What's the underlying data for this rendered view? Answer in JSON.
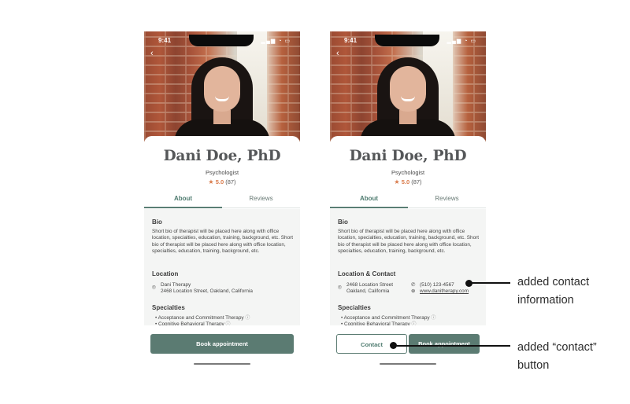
{
  "status": {
    "time": "9:41",
    "system_icons": "signal-wifi-battery"
  },
  "profile": {
    "name": "Dani Doe, PhD",
    "role": "Psychologist",
    "rating": "5.0",
    "review_count": "(87)"
  },
  "tabs": {
    "about": "About",
    "reviews": "Reviews"
  },
  "bio": {
    "heading": "Bio",
    "text": "Short bio of therapist will be placed here along with office location, specialties, education, training, background, etc. Short bio of therapist will be placed here along with office location, specialties, education, training, background, etc."
  },
  "location": {
    "heading": "Location",
    "practice": "Dani Therapy",
    "address": "2468 Location Street, Oakland, California"
  },
  "location_contact": {
    "heading": "Location & Contact",
    "street": "2468 Location Street",
    "city": "Oakland, California",
    "phone": "(510) 123-4567",
    "website": "www.danitherapy.com"
  },
  "specialties": {
    "heading": "Specialties",
    "items": [
      "Acceptance and Commitment Therapy",
      "Cognitive Behavioral Therapy"
    ]
  },
  "buttons": {
    "book": "Book appointment",
    "contact": "Contact"
  },
  "annotations": {
    "contact_info_line1": "added contact",
    "contact_info_line2": "information",
    "contact_button_line1": "added “contact”",
    "contact_button_line2": "button"
  },
  "colors": {
    "accent": "#5b7b72",
    "rating": "#d97a4a",
    "background": "#f4f5f4"
  }
}
